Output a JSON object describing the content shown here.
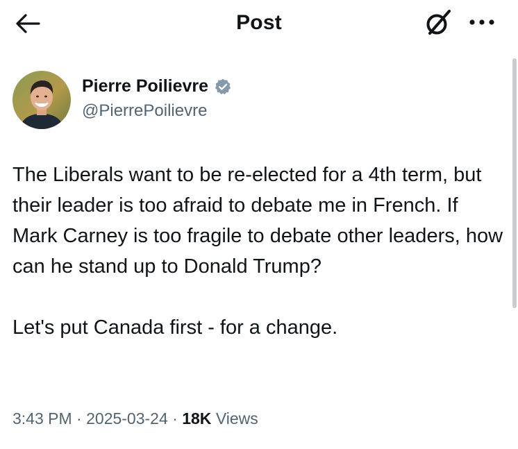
{
  "header": {
    "title": "Post",
    "back_icon": "arrow-left-icon",
    "grok_icon": "grok-icon",
    "more_icon": "more-horizontal-icon"
  },
  "author": {
    "name": "Pierre Poilievre",
    "handle": "@PierrePoilievre",
    "verified_icon": "verified-badge-icon",
    "verified_color": "#829aab"
  },
  "tweet": {
    "text": "The Liberals want to be re-elected for a 4th term, but their leader is too afraid to debate me in French. If Mark Carney is too fragile to debate other leaders, how can he stand up to Donald Trump?\n\nLet's put Canada first - for a change."
  },
  "meta": {
    "time": "3:43 PM",
    "separator": "·",
    "date": "2025-03-24",
    "views_count": "18K",
    "views_label": "Views"
  }
}
